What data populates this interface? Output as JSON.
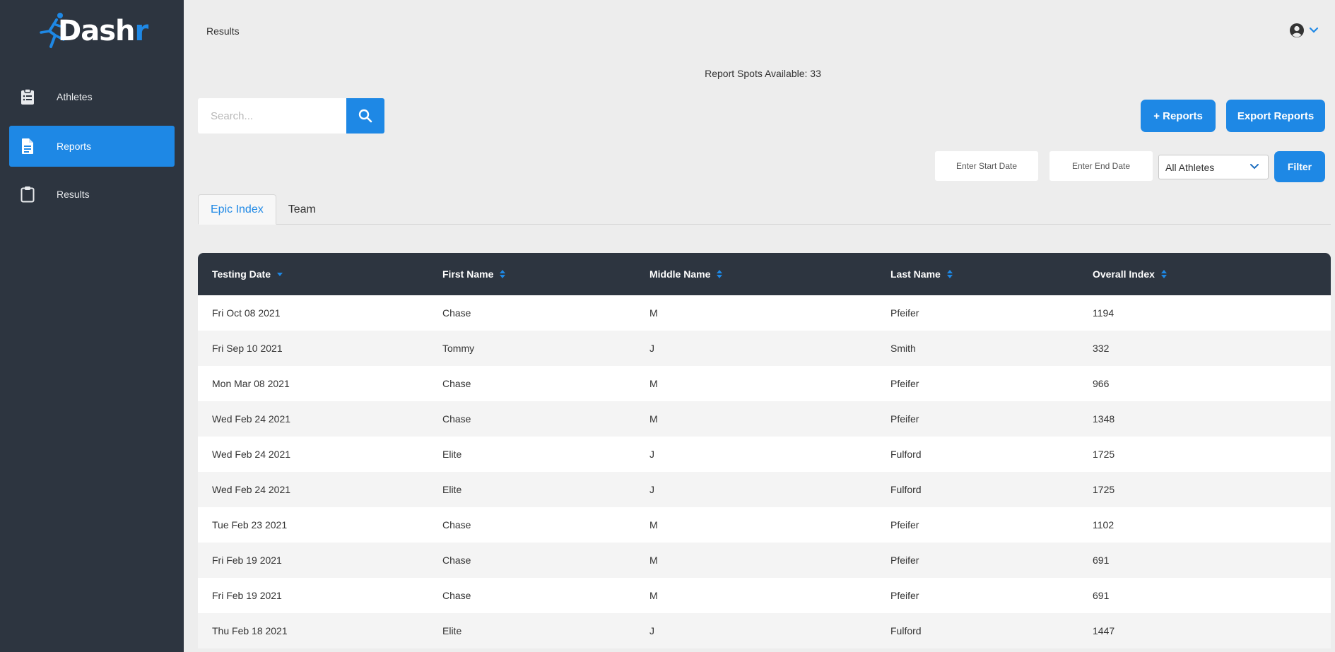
{
  "sidebar": {
    "logo": {
      "text_main": "Dash",
      "text_accent": "r"
    },
    "items": [
      {
        "label": "Athletes",
        "icon": "clipboard-list-icon",
        "active": false
      },
      {
        "label": "Reports",
        "icon": "document-icon",
        "active": true
      },
      {
        "label": "Results",
        "icon": "clipboard-icon",
        "active": false
      }
    ]
  },
  "header": {
    "breadcrumb": "Results",
    "user_icon": "user-circle-icon"
  },
  "report_spots": "Report Spots Available: 33",
  "search": {
    "placeholder": "Search...",
    "value": ""
  },
  "actions": {
    "add_reports": "+ Reports",
    "export_reports": "Export Reports"
  },
  "filters": {
    "start_date_placeholder": "Enter Start Date",
    "end_date_placeholder": "Enter End Date",
    "athlete_select": "All Athletes",
    "filter_button": "Filter"
  },
  "tabs": [
    {
      "label": "Epic Index",
      "active": true
    },
    {
      "label": "Team",
      "active": false
    }
  ],
  "table": {
    "columns": [
      "Testing Date",
      "First Name",
      "Middle Name",
      "Last Name",
      "Overall Index"
    ],
    "rows": [
      [
        "Fri Oct 08 2021",
        "Chase",
        "M",
        "Pfeifer",
        "1194"
      ],
      [
        "Fri Sep 10 2021",
        "Tommy",
        "J",
        "Smith",
        "332"
      ],
      [
        "Mon Mar 08 2021",
        "Chase",
        "M",
        "Pfeifer",
        "966"
      ],
      [
        "Wed Feb 24 2021",
        "Chase",
        "M",
        "Pfeifer",
        "1348"
      ],
      [
        "Wed Feb 24 2021",
        "Elite",
        "J",
        "Fulford",
        "1725"
      ],
      [
        "Wed Feb 24 2021",
        "Elite",
        "J",
        "Fulford",
        "1725"
      ],
      [
        "Tue Feb 23 2021",
        "Chase",
        "M",
        "Pfeifer",
        "1102"
      ],
      [
        "Fri Feb 19 2021",
        "Chase",
        "M",
        "Pfeifer",
        "691"
      ],
      [
        "Fri Feb 19 2021",
        "Chase",
        "M",
        "Pfeifer",
        "691"
      ],
      [
        "Thu Feb 18 2021",
        "Elite",
        "J",
        "Fulford",
        "1447"
      ]
    ]
  },
  "colors": {
    "accent": "#1e88e5",
    "sidebar_bg": "#2d3540",
    "page_bg": "#ededed"
  }
}
